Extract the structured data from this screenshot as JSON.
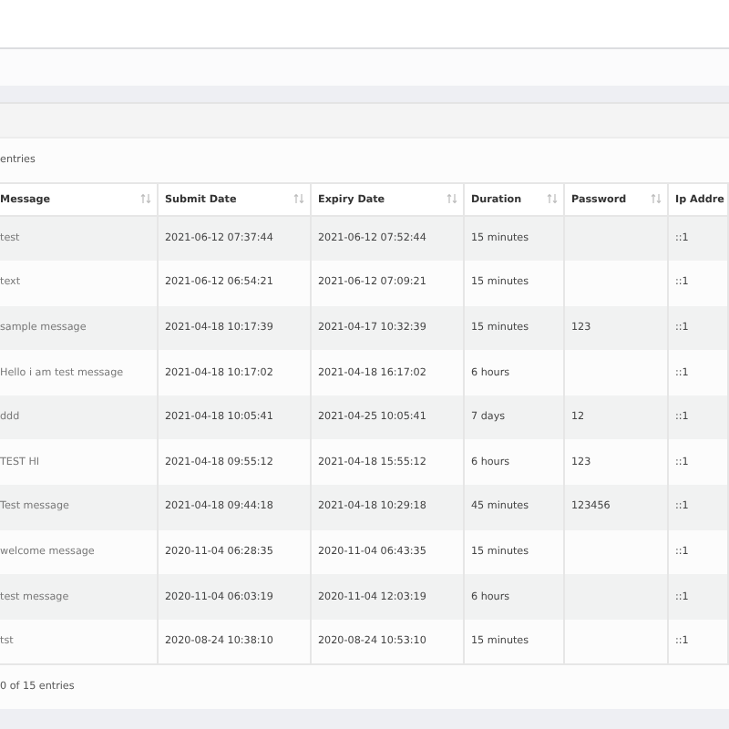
{
  "length_caption": "entries",
  "table": {
    "columns": [
      {
        "label": "Message",
        "sortable": true
      },
      {
        "label": "Submit Date",
        "sortable": true
      },
      {
        "label": "Expiry Date",
        "sortable": true
      },
      {
        "label": "Duration",
        "sortable": true
      },
      {
        "label": "Password",
        "sortable": true
      },
      {
        "label": "Ip Addre",
        "sortable": false
      }
    ],
    "rows": [
      [
        "test",
        "2021-06-12 07:37:44",
        "2021-06-12 07:52:44",
        "15 minutes",
        "",
        "::1"
      ],
      [
        "text",
        "2021-06-12 06:54:21",
        "2021-06-12 07:09:21",
        "15 minutes",
        "",
        "::1"
      ],
      [
        "sample message",
        "2021-04-18 10:17:39",
        "2021-04-17 10:32:39",
        "15 minutes",
        "123",
        "::1"
      ],
      [
        "Hello i am test message",
        "2021-04-18 10:17:02",
        "2021-04-18 16:17:02",
        "6 hours",
        "",
        "::1"
      ],
      [
        "ddd",
        "2021-04-18 10:05:41",
        "2021-04-25 10:05:41",
        "7 days",
        "12",
        "::1"
      ],
      [
        "TEST HI",
        "2021-04-18 09:55:12",
        "2021-04-18 15:55:12",
        "6 hours",
        "123",
        "::1"
      ],
      [
        "Test message",
        "2021-04-18 09:44:18",
        "2021-04-18 10:29:18",
        "45 minutes",
        "123456",
        "::1"
      ],
      [
        "welcome message",
        "2020-11-04 06:28:35",
        "2020-11-04 06:43:35",
        "15 minutes",
        "",
        "::1"
      ],
      [
        "test message",
        "2020-11-04 06:03:19",
        "2020-11-04 12:03:19",
        "6 hours",
        "",
        "::1"
      ],
      [
        "tst",
        "2020-08-24 10:38:10",
        "2020-08-24 10:53:10",
        "15 minutes",
        "",
        "::1"
      ]
    ]
  },
  "info": "0 of 15 entries"
}
